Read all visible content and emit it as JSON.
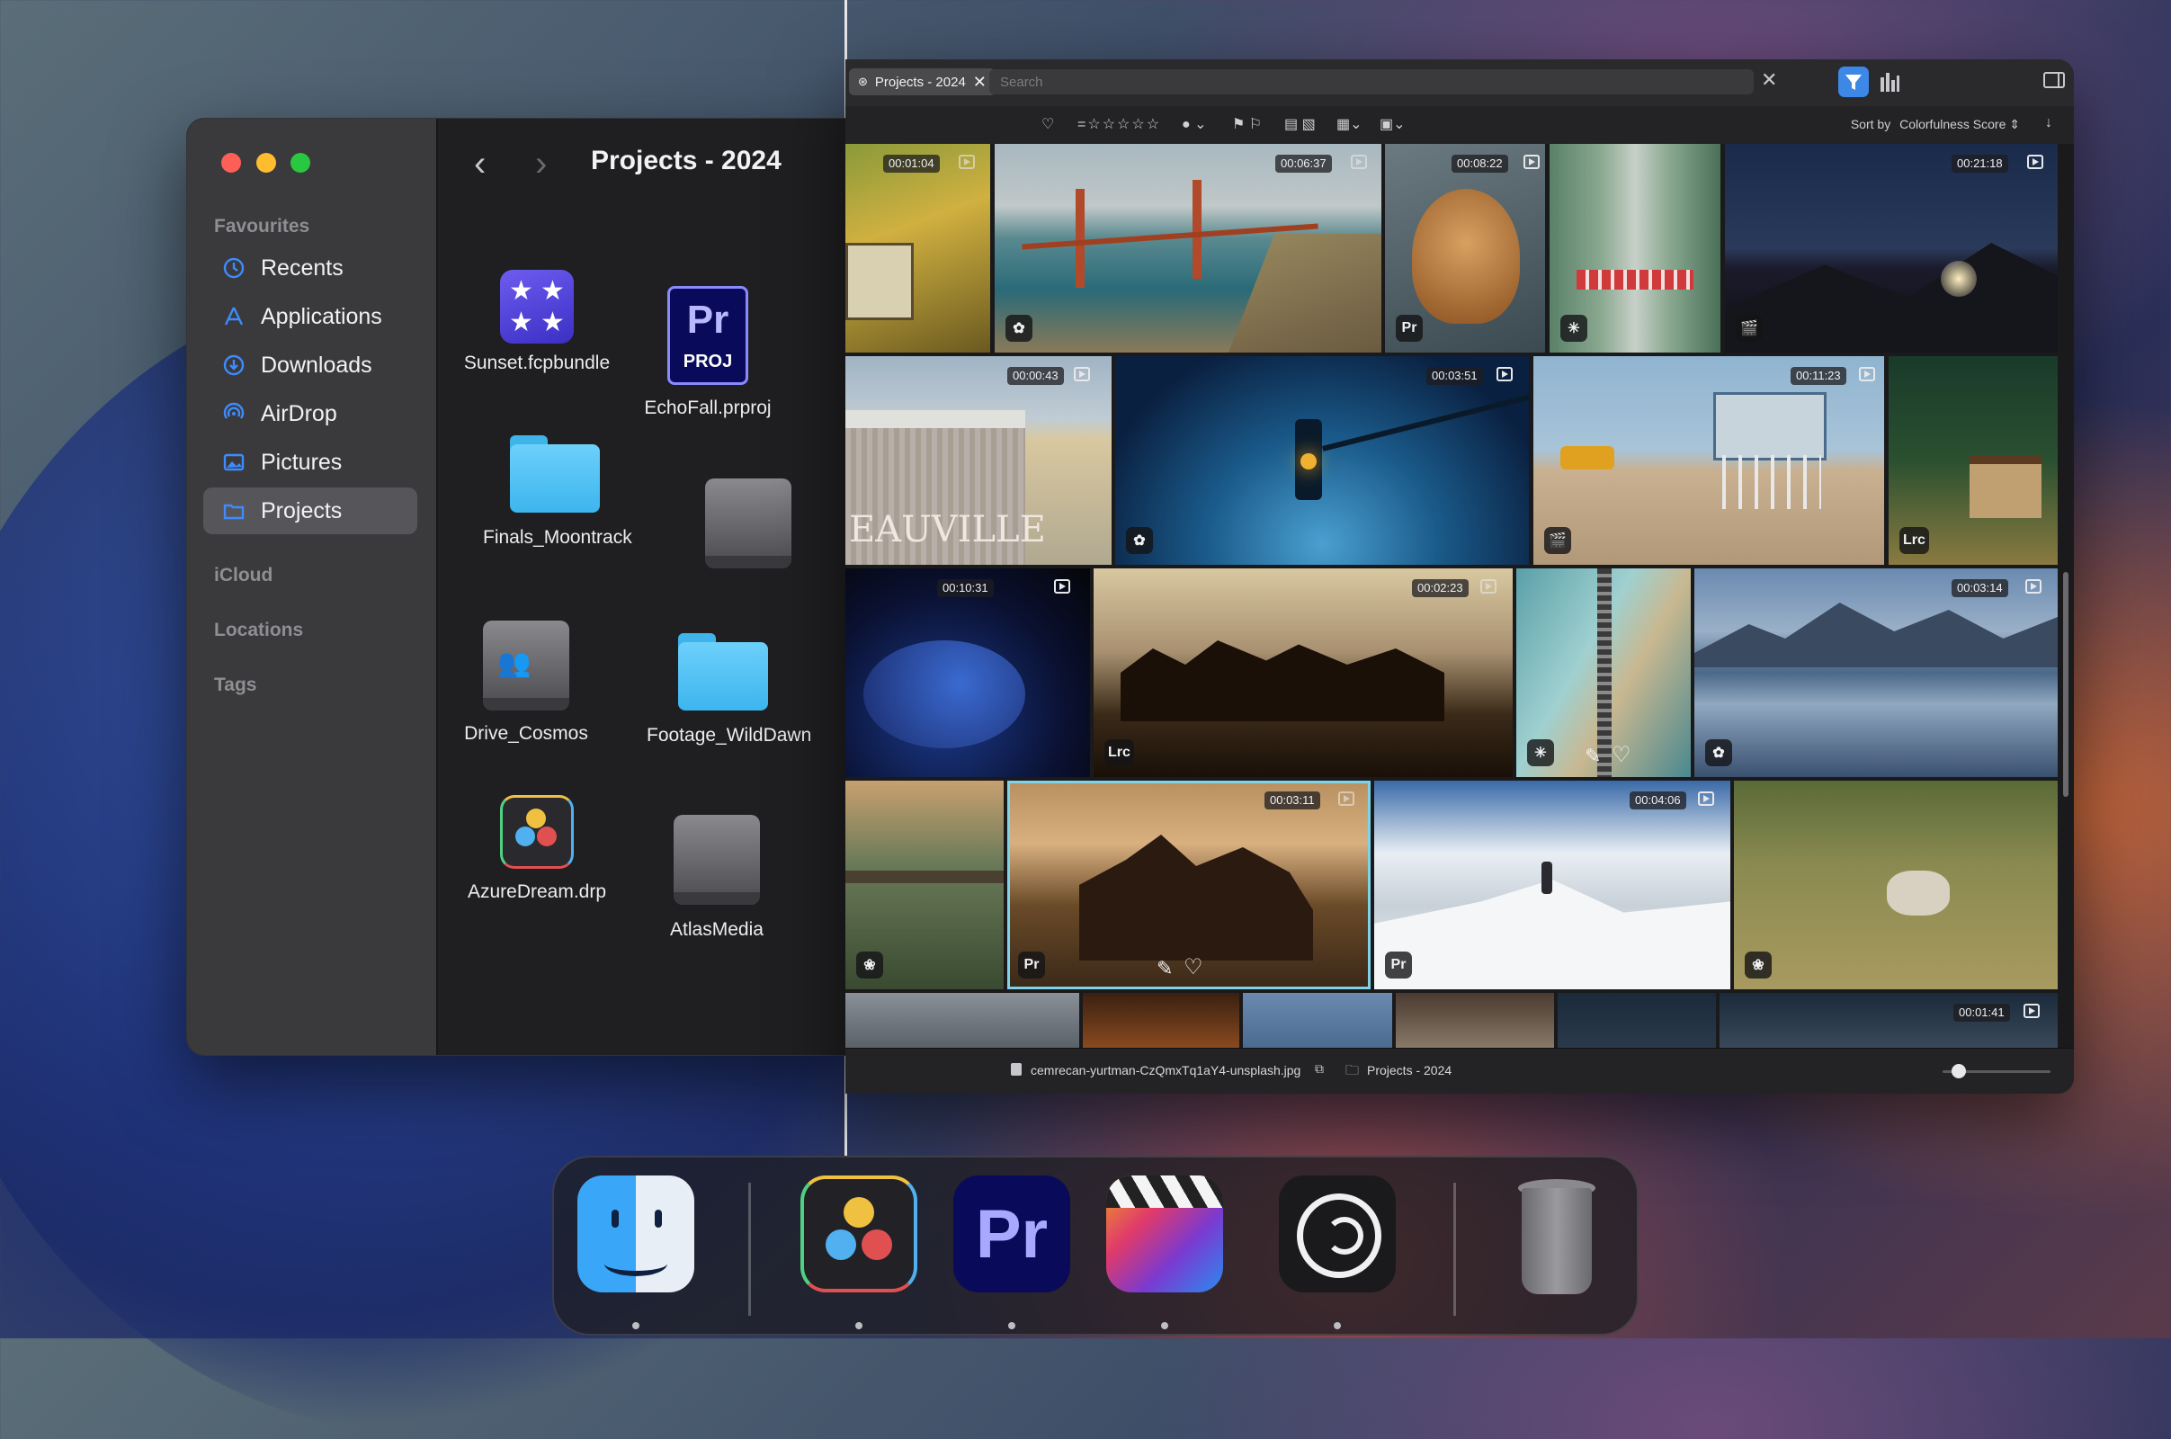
{
  "finder": {
    "title": "Projects - 2024",
    "sidebar": {
      "favourites_label": "Favourites",
      "items": [
        {
          "label": "Recents",
          "icon": "clock-icon"
        },
        {
          "label": "Applications",
          "icon": "applications-icon"
        },
        {
          "label": "Downloads",
          "icon": "download-icon"
        },
        {
          "label": "AirDrop",
          "icon": "airdrop-icon"
        },
        {
          "label": "Pictures",
          "icon": "pictures-icon"
        },
        {
          "label": "Projects",
          "icon": "folder-icon",
          "selected": true
        }
      ],
      "icloud_label": "iCloud",
      "locations_label": "Locations",
      "tags_label": "Tags"
    },
    "files": [
      {
        "name": "Sunset.fcpbundle",
        "icon": "fcp-bundle-icon"
      },
      {
        "name": "EchoFall.prproj",
        "icon": "premiere-project-icon"
      },
      {
        "name": "Finals_Moontrack",
        "icon": "folder-icon"
      },
      {
        "name": "",
        "icon": "external-drive-icon"
      },
      {
        "name": "Drive_Cosmos",
        "icon": "shared-drive-icon"
      },
      {
        "name": "Footage_WildDawn",
        "icon": "folder-icon"
      },
      {
        "name": "AzureDream.drp",
        "icon": "resolve-project-icon"
      },
      {
        "name": "AtlasMedia",
        "icon": "external-drive-icon"
      }
    ],
    "pr_text": "Pr",
    "proj_text": "PROJ"
  },
  "app": {
    "tab_label": "Projects - 2024",
    "search_placeholder": "Search",
    "sort_label": "Sort by",
    "sort_value": "Colorfulness Score",
    "rows": [
      [
        {
          "duration": "00:01:04",
          "scene": "autumn-wall"
        },
        {
          "duration": "00:06:37",
          "scene": "golden-gate"
        },
        {
          "duration": "00:08:22",
          "scene": "dog-window",
          "badge": "Pr"
        },
        {
          "duration": "",
          "scene": "aerial-beach",
          "badge": "✳"
        },
        {
          "duration": "00:21:18",
          "scene": "night-mountain",
          "badge": "clapper"
        }
      ],
      [
        {
          "duration": "00:00:43",
          "scene": "deauville-birds"
        },
        {
          "duration": "00:03:51",
          "scene": "traffic-light",
          "badge": "resolve"
        },
        {
          "duration": "00:11:23",
          "scene": "lifeguard-tower",
          "badge": "clapper"
        },
        {
          "duration": "",
          "scene": "forest-cabin",
          "badge": "Lrc"
        }
      ],
      [
        {
          "duration": "00:10:31",
          "scene": "peacock"
        },
        {
          "duration": "00:02:23",
          "scene": "horses-sunset",
          "badge": "Lrc"
        },
        {
          "duration": "",
          "scene": "aerial-coast",
          "badge": "✳"
        },
        {
          "duration": "00:03:14",
          "scene": "mountain-lake",
          "badge": "resolve"
        }
      ],
      [
        {
          "duration": "",
          "scene": "river-bridge",
          "badge": "❀"
        },
        {
          "duration": "00:03:11",
          "scene": "cowboy-horses",
          "badge": "Pr",
          "selected": true
        },
        {
          "duration": "00:04:06",
          "scene": "snow-summit",
          "badge": "Pr"
        },
        {
          "duration": "",
          "scene": "ram-field",
          "badge": "❀"
        }
      ],
      [
        {
          "duration": "00:01:41",
          "scene": "partial-row"
        }
      ]
    ],
    "status_file": "cemrecan-yurtman-CzQmxTq1aY4-unsplash.jpg",
    "status_path": "Projects - 2024"
  },
  "dock": {
    "apps": [
      {
        "name": "Finder",
        "icon": "finder-icon"
      },
      {
        "name": "DaVinci Resolve",
        "icon": "davinci-resolve-icon"
      },
      {
        "name": "Premiere Pro",
        "icon": "premiere-pro-icon",
        "label": "Pr"
      },
      {
        "name": "Final Cut Pro",
        "icon": "final-cut-pro-icon"
      },
      {
        "name": "Camera app",
        "icon": "camera-app-icon"
      },
      {
        "name": "Trash",
        "icon": "trash-icon"
      }
    ]
  }
}
